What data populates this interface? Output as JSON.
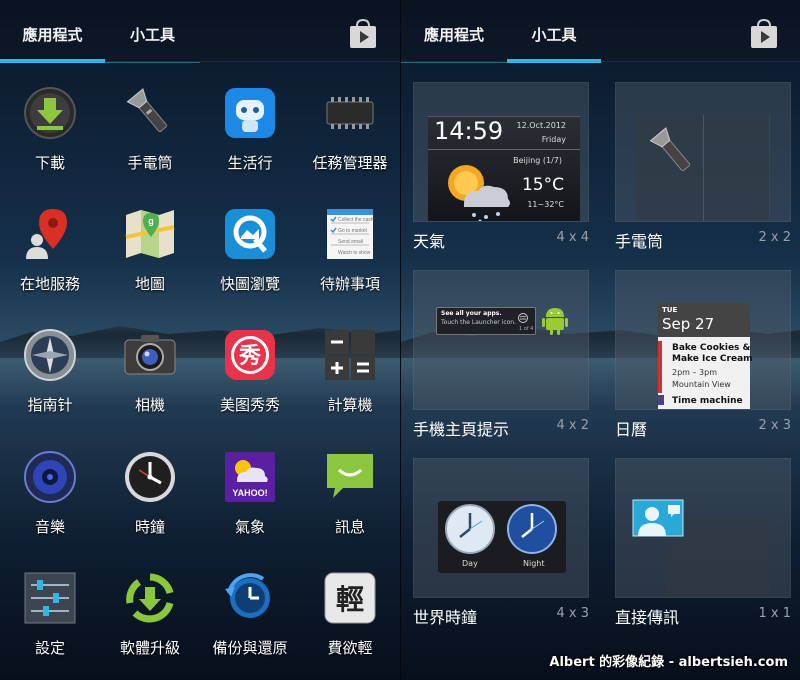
{
  "left": {
    "tabs": [
      {
        "label": "應用程式",
        "active": true
      },
      {
        "label": "小工具",
        "active": false
      }
    ],
    "apps": [
      {
        "label": "下載"
      },
      {
        "label": "手電筒"
      },
      {
        "label": "生活行"
      },
      {
        "label": "任務管理器"
      },
      {
        "label": "在地服務"
      },
      {
        "label": "地圖"
      },
      {
        "label": "快圖瀏覽"
      },
      {
        "label": "待辦事項"
      },
      {
        "label": "指南针"
      },
      {
        "label": "相機"
      },
      {
        "label": "美图秀秀"
      },
      {
        "label": "計算機"
      },
      {
        "label": "音樂"
      },
      {
        "label": "時鐘"
      },
      {
        "label": "氣象"
      },
      {
        "label": "訊息"
      },
      {
        "label": "設定"
      },
      {
        "label": "軟體升級"
      },
      {
        "label": "備份與還原"
      },
      {
        "label": "費欲輕"
      }
    ],
    "icon_text": {
      "todo_lines": [
        "Collect the cash",
        "Go to market",
        "Send email",
        "Watch tv show"
      ],
      "yahoo": "YAHOO!",
      "xiu": "秀",
      "qing": "輕"
    }
  },
  "right": {
    "tabs": [
      {
        "label": "應用程式",
        "active": false
      },
      {
        "label": "小工具",
        "active": true
      }
    ],
    "widgets": [
      {
        "name": "天氣",
        "size": "4 x 4"
      },
      {
        "name": "手電筒",
        "size": "2 x 2"
      },
      {
        "name": "手機主頁提示",
        "size": "4 x 2"
      },
      {
        "name": "日曆",
        "size": "2 x 3"
      },
      {
        "name": "世界時鐘",
        "size": "4 x 3"
      },
      {
        "name": "直接傳訊",
        "size": "1 x 1"
      }
    ],
    "weather": {
      "time": "14:59",
      "date": "12.Oct.2012",
      "day": "Friday",
      "city": "Beijing (1/7)",
      "temp": "15°C",
      "range": "11~32°C"
    },
    "tips": {
      "line1": "See all your apps.",
      "line2": "Touch the Launcher icon.",
      "page": "1 of 4"
    },
    "calendar": {
      "dow": "TUE",
      "date": "Sep 27",
      "event1": "Bake Cookies &",
      "event1b": "Make Ice Cream",
      "time": "2pm – 3pm",
      "place": "Mountain View",
      "event2": "Time machine"
    },
    "clocks": {
      "day": "Day",
      "night": "Night"
    }
  },
  "watermark": "Albert 的彩像紀錄 - albertsieh.com",
  "colors": {
    "accent": "#33b5e5",
    "tab_bg": "#0d1828"
  }
}
